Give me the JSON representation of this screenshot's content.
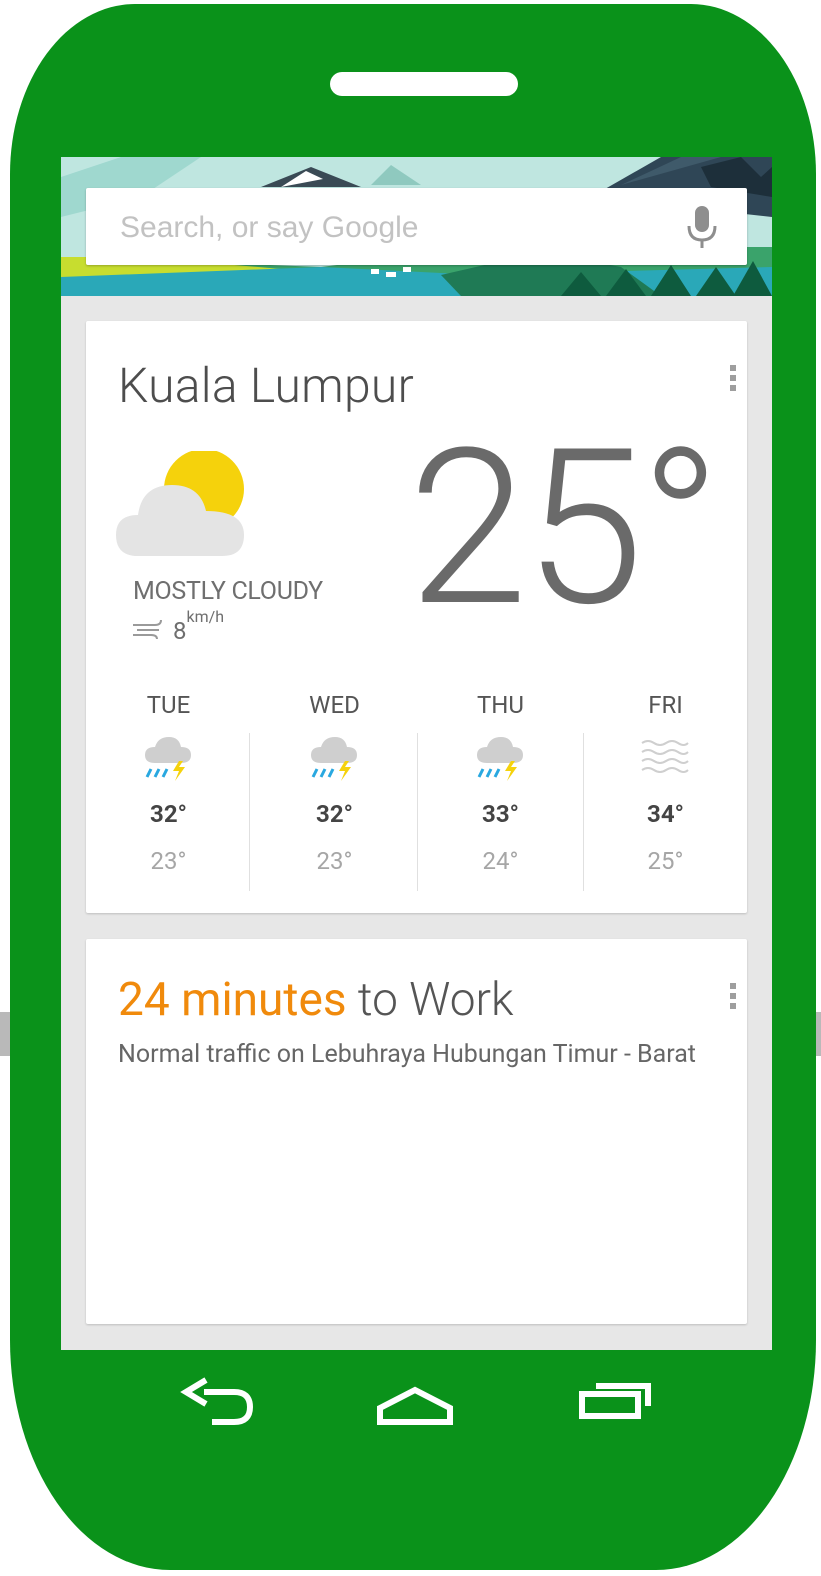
{
  "search": {
    "placeholder": "Search, or say Google"
  },
  "weather": {
    "city": "Kuala Lumpur",
    "temperature": "25°",
    "condition": "MOSTLY CLOUDY",
    "wind_value": "8",
    "wind_unit": "km/h",
    "forecast": [
      {
        "day": "TUE",
        "high": "32°",
        "low": "23°",
        "icon": "thunderstorm-icon"
      },
      {
        "day": "WED",
        "high": "32°",
        "low": "23°",
        "icon": "thunderstorm-icon"
      },
      {
        "day": "THU",
        "high": "33°",
        "low": "24°",
        "icon": "thunderstorm-icon"
      },
      {
        "day": "FRI",
        "high": "34°",
        "low": "25°",
        "icon": "haze-icon"
      }
    ]
  },
  "commute": {
    "time": "24 minutes",
    "destination": " to Work",
    "description": "Normal traffic on Lebuhraya Hubungan Timur - Barat"
  },
  "colors": {
    "phone_body": "#0a921a",
    "commute_accent": "#f08a0c",
    "sun": "#f5d20c",
    "rain": "#29a8e0"
  }
}
